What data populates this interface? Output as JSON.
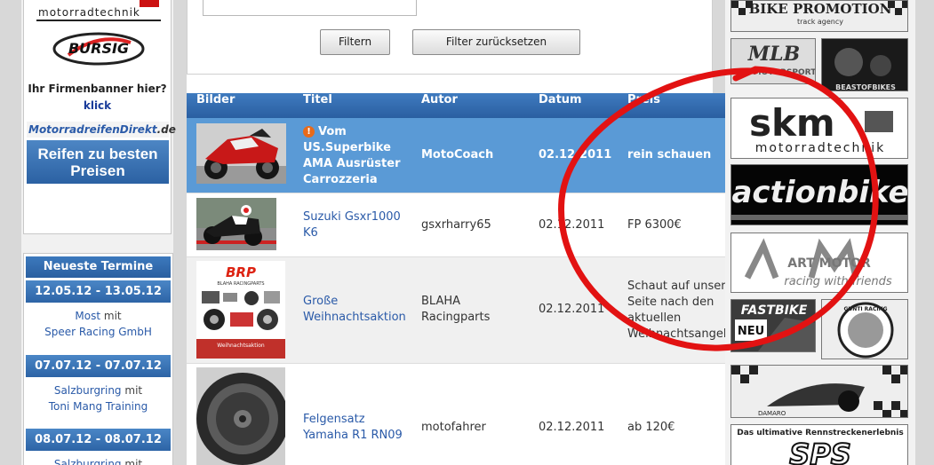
{
  "left": {
    "skm_small_text": "motorradtechnik",
    "bursig_text": "BURSIG",
    "banner_question": "Ihr Firmenbanner hier?",
    "banner_link": "klick",
    "motorradreifen_main": "MotorradreifenDirekt",
    "motorradreifen_tld": ".de",
    "reifen_line1": "Reifen zu besten",
    "reifen_line2": "Preisen"
  },
  "termine": {
    "heading": "Neueste Termine",
    "items": [
      {
        "date": "12.05.12 - 13.05.12",
        "place": "Most",
        "joiner": "mit",
        "org": "Speer Racing GmbH"
      },
      {
        "date": "07.07.12 - 07.07.12",
        "place": "Salzburgring",
        "joiner": "mit",
        "org": "Toni Mang Training"
      },
      {
        "date": "08.07.12 - 08.07.12",
        "place": "Salzburgring",
        "joiner": "mit",
        "org": ""
      }
    ]
  },
  "filter": {
    "filter_button": "Filtern",
    "reset_button": "Filter zurücksetzen"
  },
  "table": {
    "headers": [
      "Bilder",
      "Titel",
      "Autor",
      "Datum",
      "Preis"
    ],
    "rows": [
      {
        "title_lines": [
          "Vom",
          "US.Superbike",
          "AMA Ausrüster",
          "Carrozzeria"
        ],
        "author": "MotoCoach",
        "date": "02.12.2011",
        "price": "rein schauen"
      },
      {
        "title_lines": [
          "Suzuki Gsxr1000",
          "K6"
        ],
        "author": "gsxrharry65",
        "date": "02.12.2011",
        "price": "FP 6300€"
      },
      {
        "title_lines": [
          "Große",
          "Weihnachtsaktion"
        ],
        "author_lines": [
          "BLAHA",
          "Racingparts"
        ],
        "date": "02.12.2011",
        "price_lines": [
          "Schaut auf unsere",
          "Seite nach den",
          "aktuellen",
          "Weihnachtsangebote"
        ]
      },
      {
        "title_lines": [
          "Felgensatz",
          "Yamaha R1 RN09"
        ],
        "author": "motofahrer",
        "date": "02.12.2011",
        "price": "ab 120€"
      }
    ],
    "brp_logo": "BRP",
    "brp_sub": "BLAHA RACINGPARTS",
    "brp_caption": "Weihnachtsaktion"
  },
  "ads": {
    "bike_promotion": "BIKE PROMOTION",
    "bike_promotion_sub": "track agency",
    "mlb": "MLB",
    "mlb_sub": "MOTORSPORT",
    "beast": "BEASTOFBIKES",
    "skm_big": "skm",
    "skm_big_sub": "motorradtechnik",
    "actionbike": "actionbike",
    "artmotor": "ART MOTOR",
    "artmotor_sub": "racing with friends",
    "fastbike": "FASTBIKE",
    "fastbike_badge": "NEU",
    "gunti": "GUNTI RACING",
    "damaro": "DAMARO",
    "sps_caption": "Das ultimative Rennstreckenerlebnis",
    "sps": "SPS"
  },
  "colors": {
    "header_blue": "#2f67a8",
    "highlight_row": "#5a9ad6",
    "link_blue": "#2a5aa8",
    "annotation_red": "#e21212"
  }
}
